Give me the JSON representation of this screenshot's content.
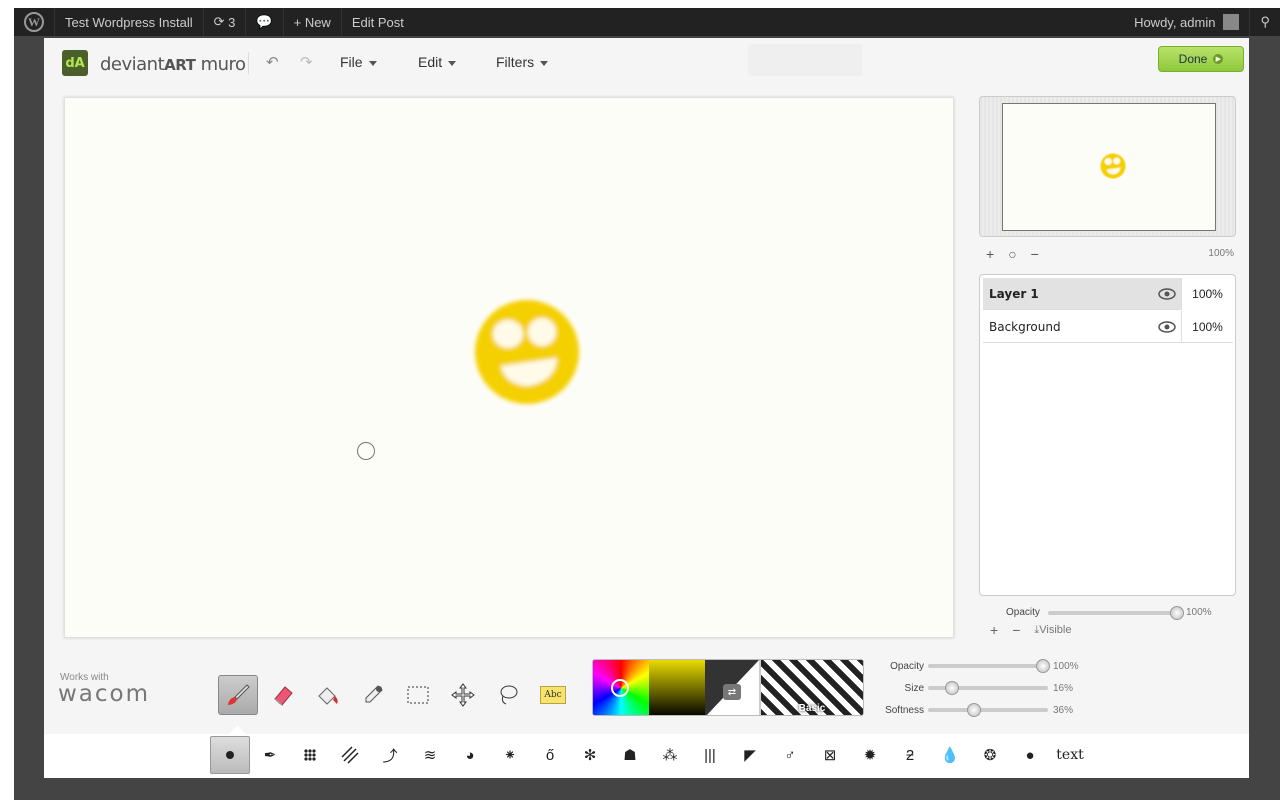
{
  "admin_bar": {
    "site_name": "Test Wordpress Install",
    "updates_count": "3",
    "new_label": "New",
    "edit_post_label": "Edit Post",
    "howdy": "Howdy, admin"
  },
  "topbar": {
    "brand_light": "deviant",
    "brand_bold": "ART",
    "brand_suffix": " muro",
    "menus": [
      "File",
      "Edit",
      "Filters"
    ],
    "done_label": "Done"
  },
  "navigator": {
    "zoom": "100%"
  },
  "layers": [
    {
      "name": "Layer 1",
      "opacity": "100%",
      "selected": true
    },
    {
      "name": "Background",
      "opacity": "100%",
      "selected": false
    }
  ],
  "layer_options": {
    "opacity_label": "Opacity",
    "opacity_value": "100%",
    "visible_label": "Visible"
  },
  "branding": {
    "works_with": "Works with",
    "wacom": "wacom"
  },
  "tools": [
    {
      "name": "brush-tool",
      "icon": "paintbrush-icon",
      "selected": true
    },
    {
      "name": "eraser-tool",
      "icon": "eraser-icon",
      "selected": false
    },
    {
      "name": "fill-tool",
      "icon": "bucket-icon",
      "selected": false
    },
    {
      "name": "eyedropper-tool",
      "icon": "eyedropper-icon",
      "selected": false
    },
    {
      "name": "select-tool",
      "icon": "marquee-icon",
      "selected": false
    },
    {
      "name": "move-tool",
      "icon": "move-icon",
      "selected": false
    },
    {
      "name": "lasso-tool",
      "icon": "lasso-icon",
      "selected": false
    },
    {
      "name": "text-tool",
      "icon": "abc-icon",
      "selected": false
    }
  ],
  "text_tool_label": "Abc",
  "color": {
    "texture_label": "Basic",
    "primary": "#f0d000"
  },
  "brush_settings": [
    {
      "label": "Opacity",
      "value": "100%",
      "level": 1.0
    },
    {
      "label": "Size",
      "value": "16%",
      "level": 0.16
    },
    {
      "label": "Softness",
      "value": "36%",
      "level": 0.36
    }
  ],
  "brushes": [
    "dot",
    "pen",
    "dots",
    "hatch",
    "squiggle",
    "swirl",
    "pie",
    "drops",
    "bubbles",
    "splatter",
    "drip",
    "sparkle",
    "lines",
    "feather",
    "chain",
    "mesh",
    "starburst",
    "curl",
    "drop",
    "sponge",
    "ball",
    "text"
  ],
  "text_brush_label": "text"
}
